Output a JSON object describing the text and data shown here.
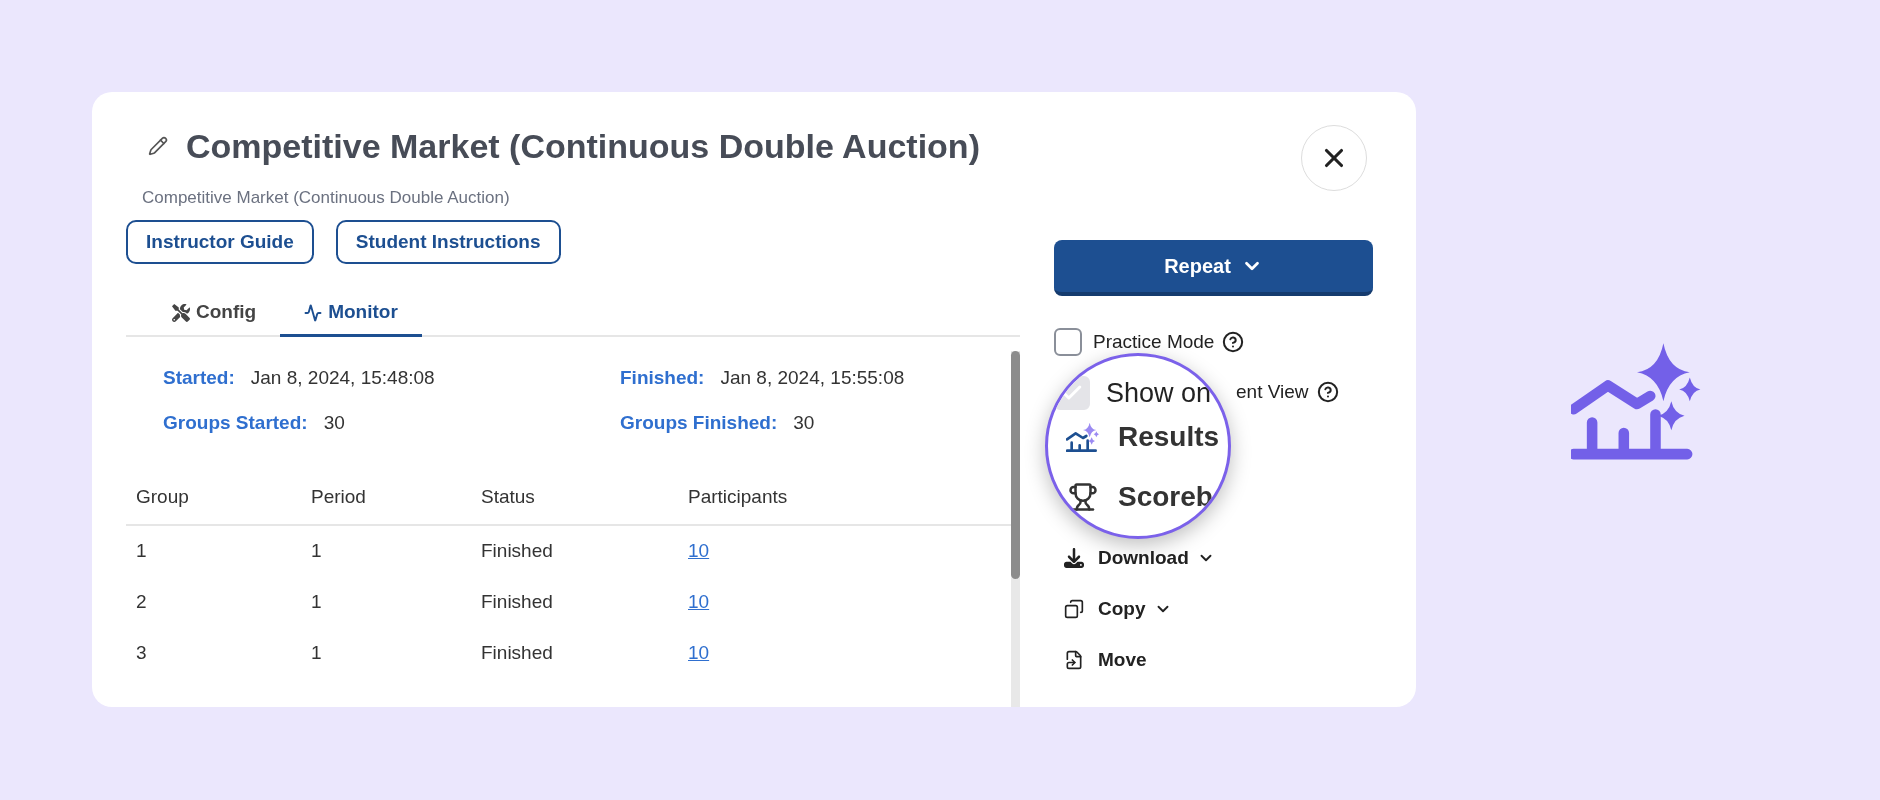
{
  "dialog": {
    "title": "Competitive Market (Continuous Double Auction)",
    "subtitle": "Competitive Market (Continuous Double Auction)",
    "guide_buttons": [
      "Instructor Guide",
      "Student Instructions"
    ],
    "tabs": [
      {
        "label": "Config",
        "selected": false
      },
      {
        "label": "Monitor",
        "selected": true
      }
    ],
    "summary": [
      {
        "label": "Started:",
        "value": "Jan 8, 2024, 15:48:08"
      },
      {
        "label": "Finished:",
        "value": "Jan 8, 2024, 15:55:08"
      },
      {
        "label": "Groups Started:",
        "value": "30"
      },
      {
        "label": "Groups Finished:",
        "value": "30"
      }
    ],
    "table": {
      "columns": [
        "Group",
        "Period",
        "Status",
        "Participants"
      ],
      "rows": [
        [
          "1",
          "1",
          "Finished",
          "10"
        ],
        [
          "2",
          "1",
          "Finished",
          "10"
        ],
        [
          "3",
          "1",
          "Finished",
          "10"
        ]
      ]
    },
    "repeat_button": "Repeat",
    "options": [
      {
        "label": "Practice Mode",
        "checked": false
      },
      {
        "label": "ent View"
      }
    ],
    "magnifier": {
      "checkbox": {
        "checked": true,
        "disabled": true
      },
      "label": "Show on",
      "items": [
        {
          "label": "Results"
        },
        {
          "label": "Scoreb"
        }
      ]
    },
    "menu": [
      {
        "label": "Download",
        "dropdown": true
      },
      {
        "label": "Copy",
        "dropdown": true
      },
      {
        "label": "Move",
        "dropdown": false
      }
    ]
  }
}
